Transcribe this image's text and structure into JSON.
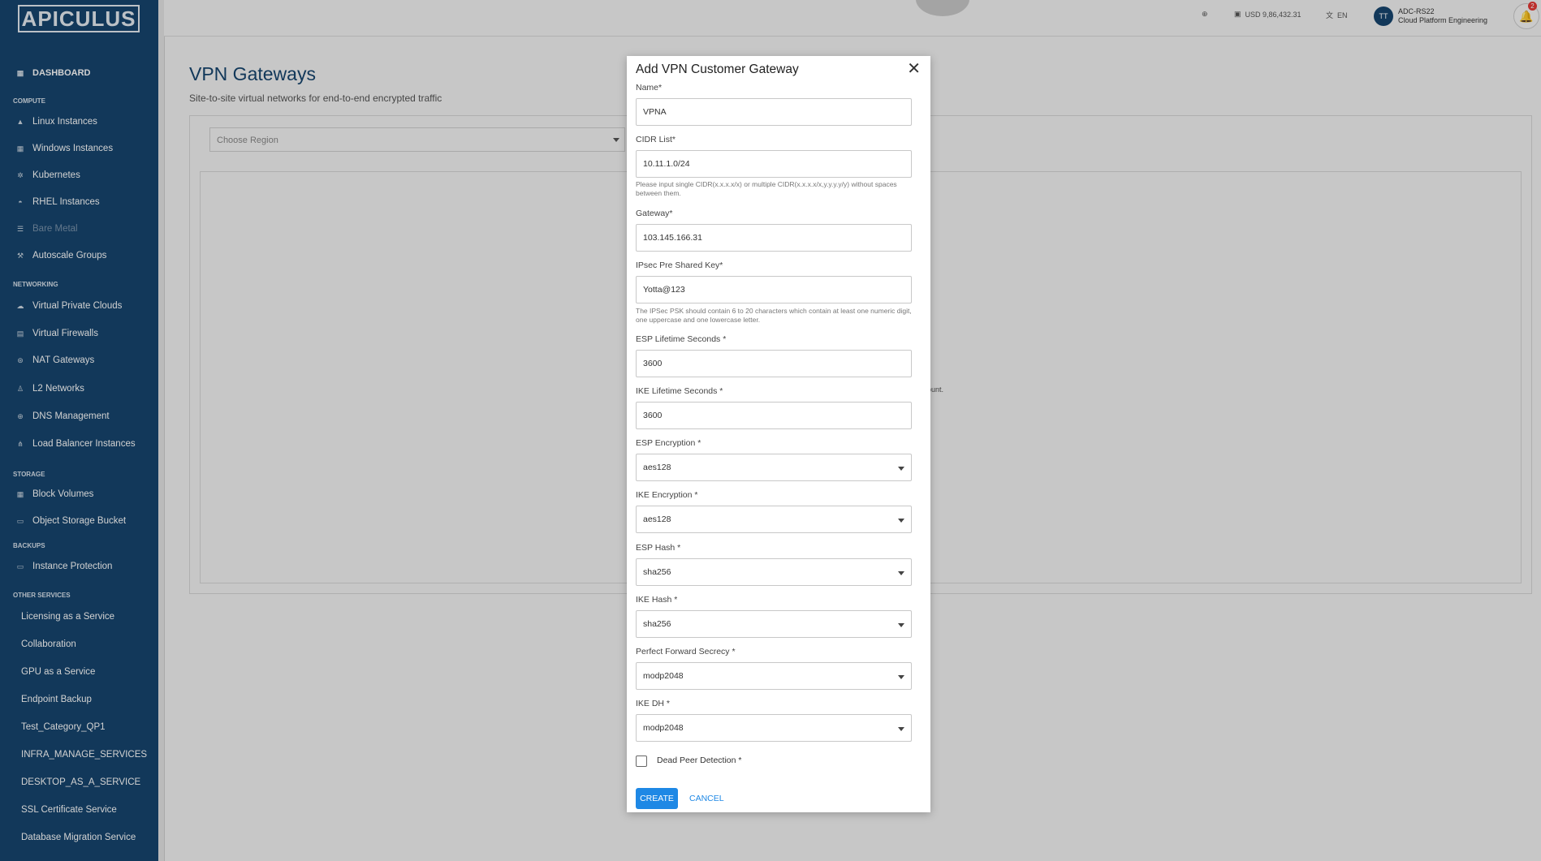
{
  "app": {
    "logo": "APICULUS"
  },
  "sidebar": {
    "dashboard": "DASHBOARD",
    "sections": {
      "compute": "COMPUTE",
      "networking": "NETWORKING",
      "storage": "STORAGE",
      "backups": "BACKUPS",
      "other": "OTHER SERVICES"
    },
    "compute_items": [
      "Linux Instances",
      "Windows Instances",
      "Kubernetes",
      "RHEL Instances",
      "Bare Metal",
      "Autoscale Groups"
    ],
    "networking_items": [
      "Virtual Private Clouds",
      "Virtual Firewalls",
      "NAT Gateways",
      "L2 Networks",
      "DNS Management",
      "Load Balancer Instances"
    ],
    "storage_items": [
      "Block Volumes",
      "Object Storage Bucket"
    ],
    "backup_items": [
      "Instance Protection"
    ],
    "other_items": [
      "Licensing as a Service",
      "Collaboration",
      "GPU as a Service",
      "Endpoint Backup",
      "Test_Category_QP1",
      "INFRA_MANAGE_SERVICES",
      "DESKTOP_AS_A_SERVICE",
      "SSL Certificate Service",
      "Database Migration Service"
    ]
  },
  "topbar": {
    "balance": "USD 9,86,432.31",
    "language": "EN",
    "avatar_initials": "TT",
    "account_id": "ADC-RS22",
    "account_org": "Cloud Platform Engineering",
    "notification_count": "2"
  },
  "page": {
    "title": "VPN Gateways",
    "subtitle": "Site-to-site virtual networks for end-to-end encrypted traffic",
    "region_placeholder": "Choose Region",
    "peek_text": "ount."
  },
  "modal": {
    "title": "Add VPN Customer Gateway",
    "name_label": "Name*",
    "name_value": "VPNA",
    "cidr_label": "CIDR List*",
    "cidr_value": "10.11.1.0/24",
    "cidr_hint": "Please input single CIDR(x.x.x.x/x) or multiple CIDR(x.x.x.x/x,y.y.y.y/y) without spaces between them.",
    "gateway_label": "Gateway*",
    "gateway_value": "103.145.166.31",
    "psk_label": "IPsec Pre Shared Key*",
    "psk_value": "Yotta@123",
    "psk_hint": "The IPSec PSK should contain 6 to 20 characters which contain at least one numeric digit, one uppercase and one lowercase letter.",
    "esp_lifetime_label": "ESP Lifetime Seconds *",
    "esp_lifetime_value": "3600",
    "ike_lifetime_label": "IKE Lifetime Seconds *",
    "ike_lifetime_value": "3600",
    "esp_enc_label": "ESP Encryption *",
    "esp_enc_value": "aes128",
    "ike_enc_label": "IKE Encryption *",
    "ike_enc_value": "aes128",
    "esp_hash_label": "ESP Hash *",
    "esp_hash_value": "sha256",
    "ike_hash_label": "IKE Hash *",
    "ike_hash_value": "sha256",
    "pfs_label": "Perfect Forward Secrecy *",
    "pfs_value": "modp2048",
    "ike_dh_label": "IKE DH *",
    "ike_dh_value": "modp2048",
    "dpd_label": "Dead Peer Detection *",
    "create_label": "CREATE",
    "cancel_label": "CANCEL"
  },
  "colors": {
    "sidebar": "#16456e",
    "accent": "#1e88e5",
    "title": "#16456e"
  }
}
